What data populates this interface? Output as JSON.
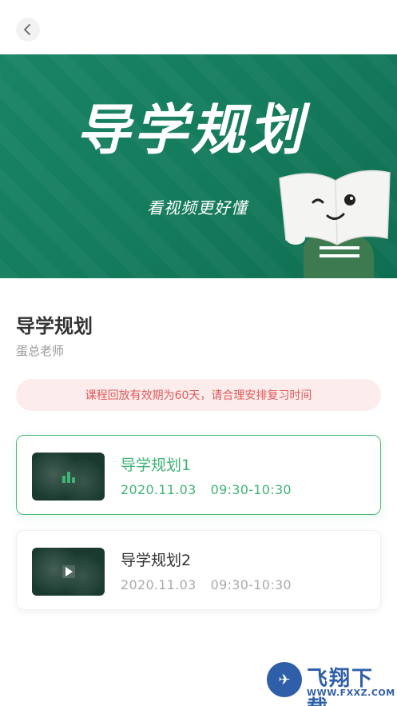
{
  "banner": {
    "title": "导学规划",
    "subtitle": "看视频更好懂"
  },
  "course": {
    "title": "导学规划",
    "teacher": "蛋总老师"
  },
  "notice": "课程回放有效期为60天，请合理安排复习时间",
  "lessons": [
    {
      "name": "导学规划1",
      "date": "2020.11.03",
      "time": "09:30-10:30",
      "state": "playing"
    },
    {
      "name": "导学规划2",
      "date": "2020.11.03",
      "time": "09:30-10:30",
      "state": "paused"
    }
  ],
  "watermark": {
    "text": "飞翔下载",
    "url": "WWW.FXXZ.COM"
  },
  "colors": {
    "accent": "#3fb374",
    "banner": "#147a5c",
    "notice_bg": "#fdecec",
    "notice_text": "#e05a5a"
  },
  "icons": {
    "back": "chevron-left-icon",
    "playing": "audio-bars-icon",
    "play": "play-icon"
  }
}
